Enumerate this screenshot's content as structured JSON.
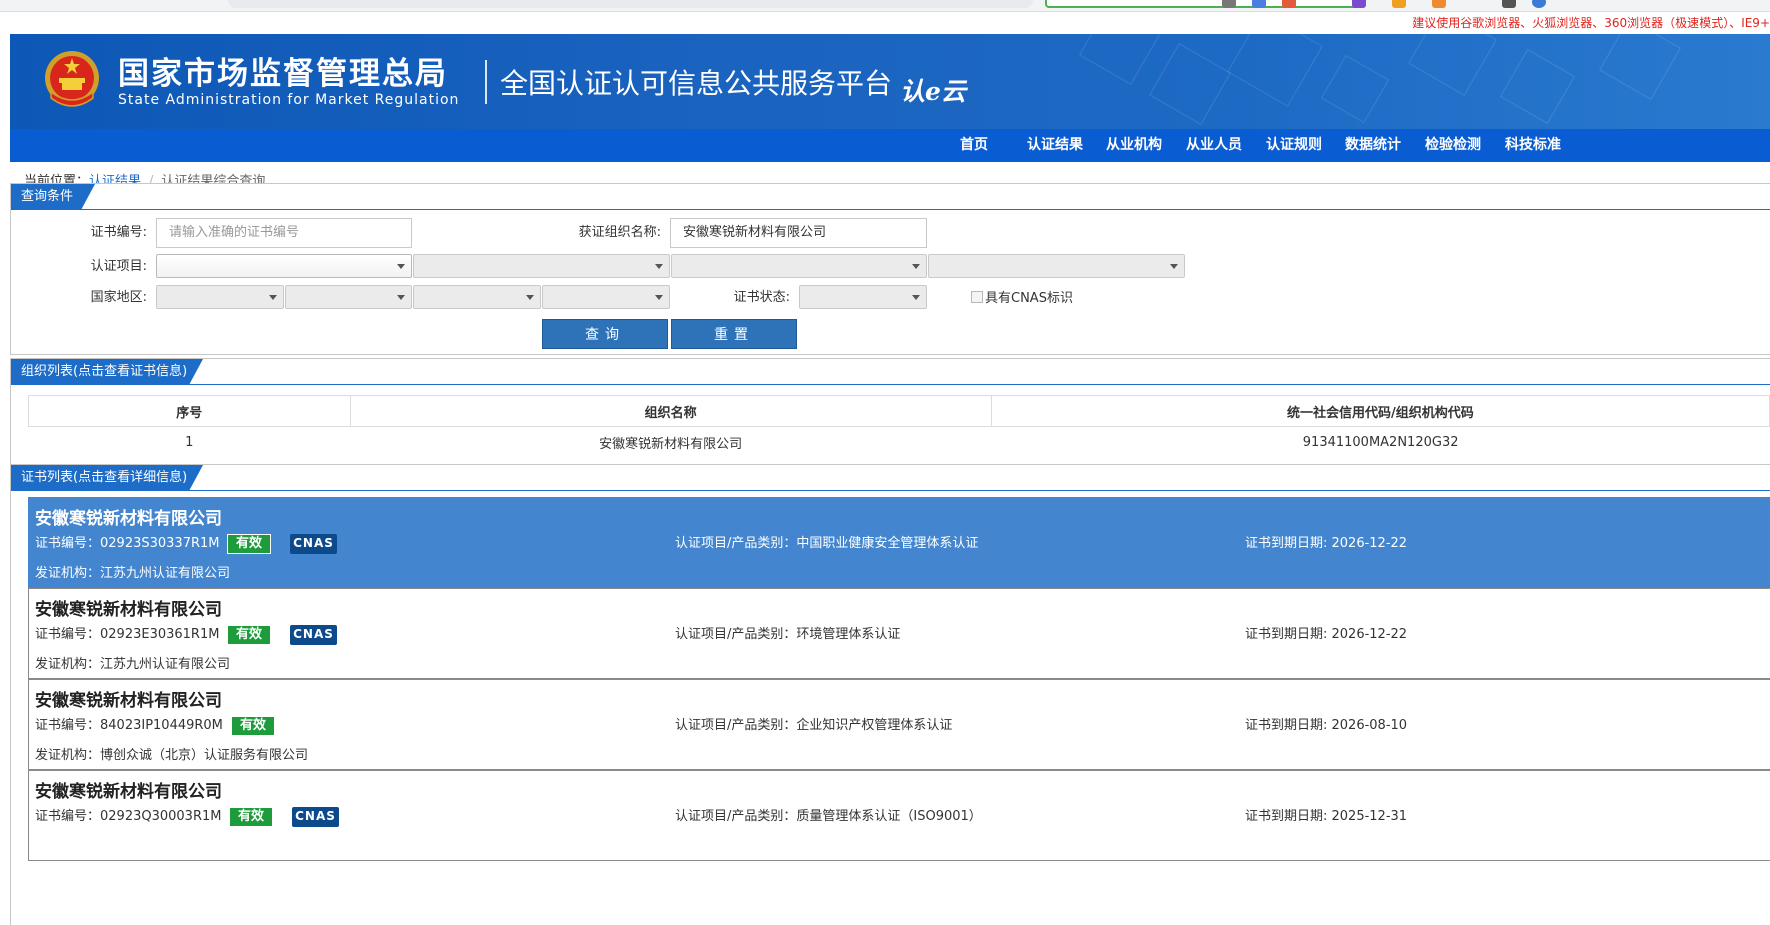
{
  "notice": "建议使用谷歌浏览器、火狐浏览器、360浏览器（极速模式）、IE9+",
  "header": {
    "agency_cn": "国家市场监督管理总局",
    "agency_en": "State Administration  for  Market Regulation",
    "platform": "全国认证认可信息公共服务平台",
    "platform_logo": "认e云"
  },
  "nav": [
    "首页",
    "认证结果",
    "从业机构",
    "从业人员",
    "认证规则",
    "数据统计",
    "检验检测",
    "科技标准"
  ],
  "breadcrumb": {
    "label": "当前位置：",
    "link": "认证结果",
    "current": "认证结果综合查询"
  },
  "query": {
    "tab": "查询条件",
    "cert_no_label": "证书编号:",
    "cert_no_placeholder": "请输入准确的证书编号",
    "org_name_label": "获证组织名称:",
    "org_name_value": "安徽寒锐新材料有限公司",
    "project_label": "认证项目:",
    "region_label": "国家地区:",
    "status_label": "证书状态:",
    "cnas_label": "具有CNAS标识",
    "search_button": "查询",
    "reset_button": "重置"
  },
  "org_list": {
    "tab": "组织列表(点击查看证书信息)",
    "columns": [
      "序号",
      "组织名称",
      "统一社会信用代码/组织机构代码"
    ],
    "rows": [
      [
        "1",
        "安徽寒锐新材料有限公司",
        "91341100MA2N120G32"
      ]
    ]
  },
  "cert_list": {
    "tab": "证书列表(点击查看详细信息)",
    "items": [
      {
        "org": "安徽寒锐新材料有限公司",
        "cert_no": "证书编号：02923S30337R1M",
        "status": "有效",
        "cnas": "CNAS",
        "project": "认证项目/产品类别：中国职业健康安全管理体系认证",
        "expiry": "证书到期日期: 2026-12-22",
        "issuer": "发证机构：江苏九州认证有限公司"
      },
      {
        "org": "安徽寒锐新材料有限公司",
        "cert_no": "证书编号：02923E30361R1M",
        "status": "有效",
        "cnas": "CNAS",
        "project": "认证项目/产品类别：环境管理体系认证",
        "expiry": "证书到期日期: 2026-12-22",
        "issuer": "发证机构：江苏九州认证有限公司"
      },
      {
        "org": "安徽寒锐新材料有限公司",
        "cert_no": "证书编号：84023IP10449R0M",
        "status": "有效",
        "cnas": "",
        "project": "认证项目/产品类别：企业知识产权管理体系认证",
        "expiry": "证书到期日期: 2026-08-10",
        "issuer": "发证机构：博创众诚（北京）认证服务有限公司"
      },
      {
        "org": "安徽寒锐新材料有限公司",
        "cert_no": "证书编号：02923Q30003R1M",
        "status": "有效",
        "cnas": "CNAS",
        "project": "认证项目/产品类别：质量管理体系认证（ISO9001）",
        "expiry": "证书到期日期: 2025-12-31",
        "issuer": ""
      }
    ]
  },
  "colors": {
    "nav": "#0a5cd3",
    "banner": "#1a63bf",
    "accent": "#1c6cc8",
    "active_card": "#4386cf",
    "valid": "#1e9b3a",
    "cnas": "#0c4a8c",
    "notice": "#e0231b"
  }
}
